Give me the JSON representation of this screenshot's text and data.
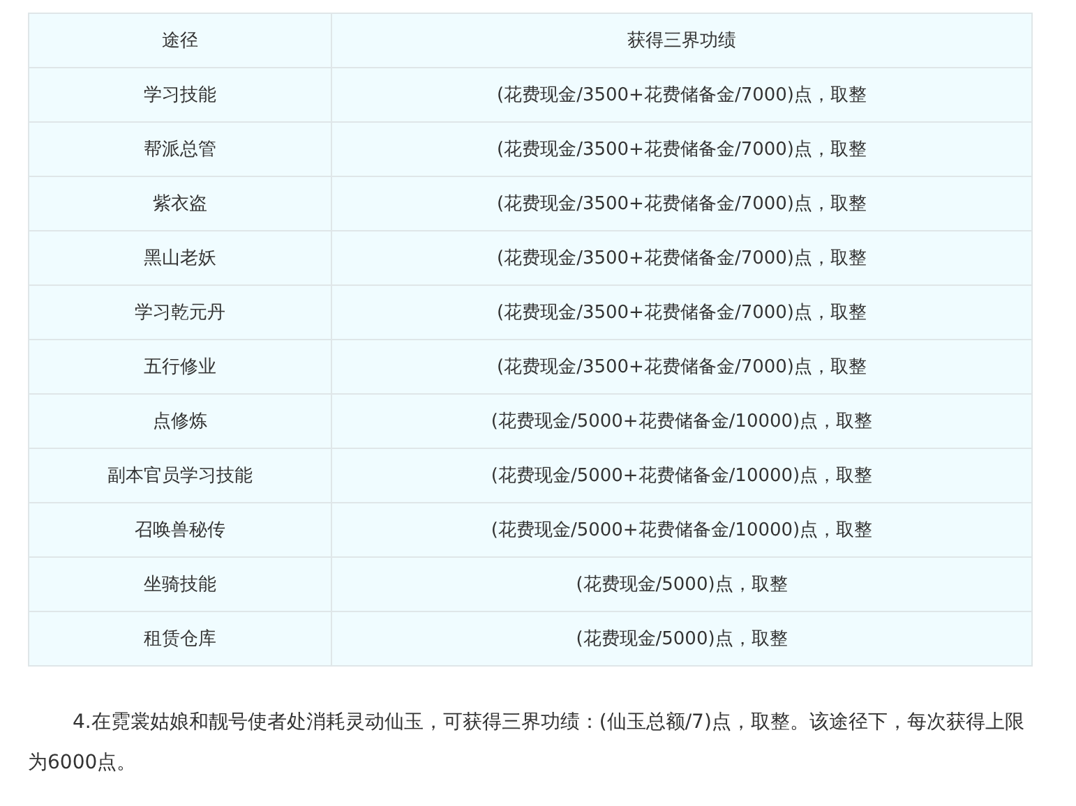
{
  "table": {
    "columns": [
      "途径",
      "获得三界功绩"
    ],
    "rows": [
      [
        "学习技能",
        "(花费现金/3500+花费储备金/7000)点，取整"
      ],
      [
        "帮派总管",
        "(花费现金/3500+花费储备金/7000)点，取整"
      ],
      [
        "紫衣盗",
        "(花费现金/3500+花费储备金/7000)点，取整"
      ],
      [
        "黑山老妖",
        "(花费现金/3500+花费储备金/7000)点，取整"
      ],
      [
        "学习乾元丹",
        "(花费现金/3500+花费储备金/7000)点，取整"
      ],
      [
        "五行修业",
        "(花费现金/3500+花费储备金/7000)点，取整"
      ],
      [
        "点修炼",
        "(花费现金/5000+花费储备金/10000)点，取整"
      ],
      [
        "副本官员学习技能",
        "(花费现金/5000+花费储备金/10000)点，取整"
      ],
      [
        "召唤兽秘传",
        "(花费现金/5000+花费储备金/10000)点，取整"
      ],
      [
        "坐骑技能",
        "(花费现金/5000)点，取整"
      ],
      [
        "租赁仓库",
        "(花费现金/5000)点，取整"
      ]
    ]
  },
  "paragraph": "4.在霓裳姑娘和靓号使者处消耗灵动仙玉，可获得三界功绩：(仙玉总额/7)点，取整。该途径下，每次获得上限为6000点。"
}
